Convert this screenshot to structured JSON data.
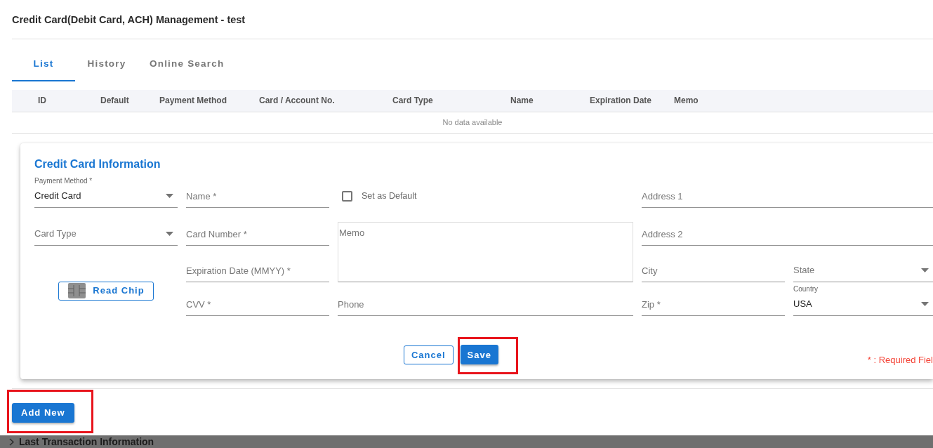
{
  "dialog": {
    "title": "Credit Card(Debit Card, ACH) Management - test"
  },
  "tabs": [
    {
      "label": "List",
      "selected": true
    },
    {
      "label": "History",
      "selected": false
    },
    {
      "label": "Online Search",
      "selected": false
    }
  ],
  "table": {
    "columns": [
      "ID",
      "Default",
      "Payment Method",
      "Card / Account No.",
      "Card Type",
      "Name",
      "Expiration Date",
      "Memo"
    ],
    "empty_message": "No data available"
  },
  "form": {
    "title": "Credit Card Information",
    "fields": [
      {
        "kind": "select",
        "label": "Payment Method *",
        "value": "Credit Card"
      },
      {
        "kind": "text",
        "placeholder": "Name *"
      },
      {
        "kind": "checkbox",
        "label": "Set as Default",
        "checked": false
      },
      {
        "kind": "text",
        "placeholder": "Address 1"
      },
      {
        "kind": "select",
        "placeholder": "Card Type"
      },
      {
        "kind": "text",
        "placeholder": "Card Number *"
      },
      {
        "kind": "textarea",
        "placeholder": "Memo"
      },
      {
        "kind": "text",
        "placeholder": "Address 2"
      },
      {
        "kind": "button",
        "label": "Read Chip"
      },
      {
        "kind": "text",
        "placeholder": "Expiration Date (MMYY) *"
      },
      {
        "kind": "text",
        "placeholder": "City"
      },
      {
        "kind": "select",
        "placeholder": "State"
      },
      {
        "kind": "text",
        "placeholder": "CVV *"
      },
      {
        "kind": "text",
        "placeholder": "Phone"
      },
      {
        "kind": "text",
        "placeholder": "Zip *"
      },
      {
        "kind": "select",
        "label": "Country",
        "value": "USA"
      }
    ],
    "buttons": [
      {
        "label": "Cancel",
        "kind": "outline",
        "highlighted": false
      },
      {
        "label": "Save",
        "kind": "primary",
        "highlighted": true
      }
    ],
    "required_note": "* : Required Fiel"
  },
  "add_new_button": {
    "label": "Add New",
    "highlighted": true
  },
  "background": {
    "section_title": "Last Transaction Information"
  }
}
